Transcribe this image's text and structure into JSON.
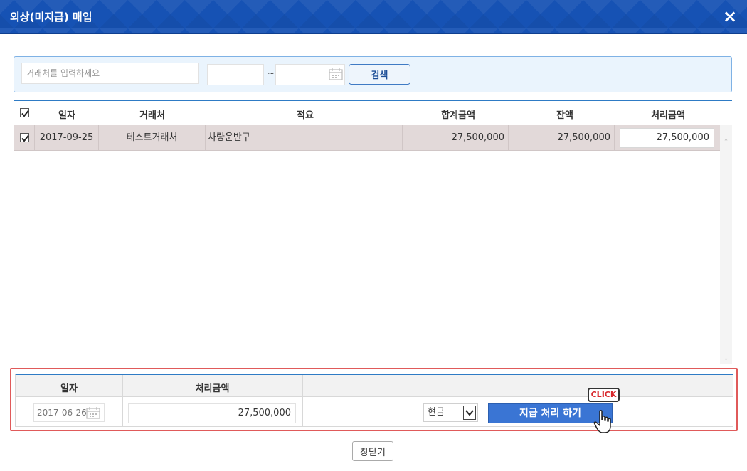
{
  "window": {
    "title": "외상(미지급) 매입",
    "close_icon": "×"
  },
  "search": {
    "vendor_placeholder": "거래처를 입력하세요",
    "date_from": "",
    "date_to": "",
    "range_separator": "~",
    "button_label": "검색"
  },
  "grid": {
    "columns": [
      "일자",
      "거래처",
      "적요",
      "합계금액",
      "잔액",
      "처리금액"
    ],
    "header_checked": true,
    "rows": [
      {
        "checked": true,
        "date": "2017-09-25",
        "vendor": "테스트거래처",
        "memo": "차량운반구",
        "total": "27,500,000",
        "balance": "27,500,000",
        "amount": "27,500,000"
      }
    ]
  },
  "payment": {
    "col_date": "일자",
    "col_amount": "처리금액",
    "date": "2017-06-26",
    "amount": "27,500,000",
    "method": "현금",
    "pay_button": "지급 처리 하기",
    "callout": "CLICK"
  },
  "footer": {
    "close_button": "창닫기"
  },
  "colors": {
    "title_bar": "#1652b4",
    "accent": "#2e7bc5",
    "highlight_row": "#e2d9d9",
    "annotation": "#e05a5a",
    "pay_button": "#3a75d4"
  }
}
